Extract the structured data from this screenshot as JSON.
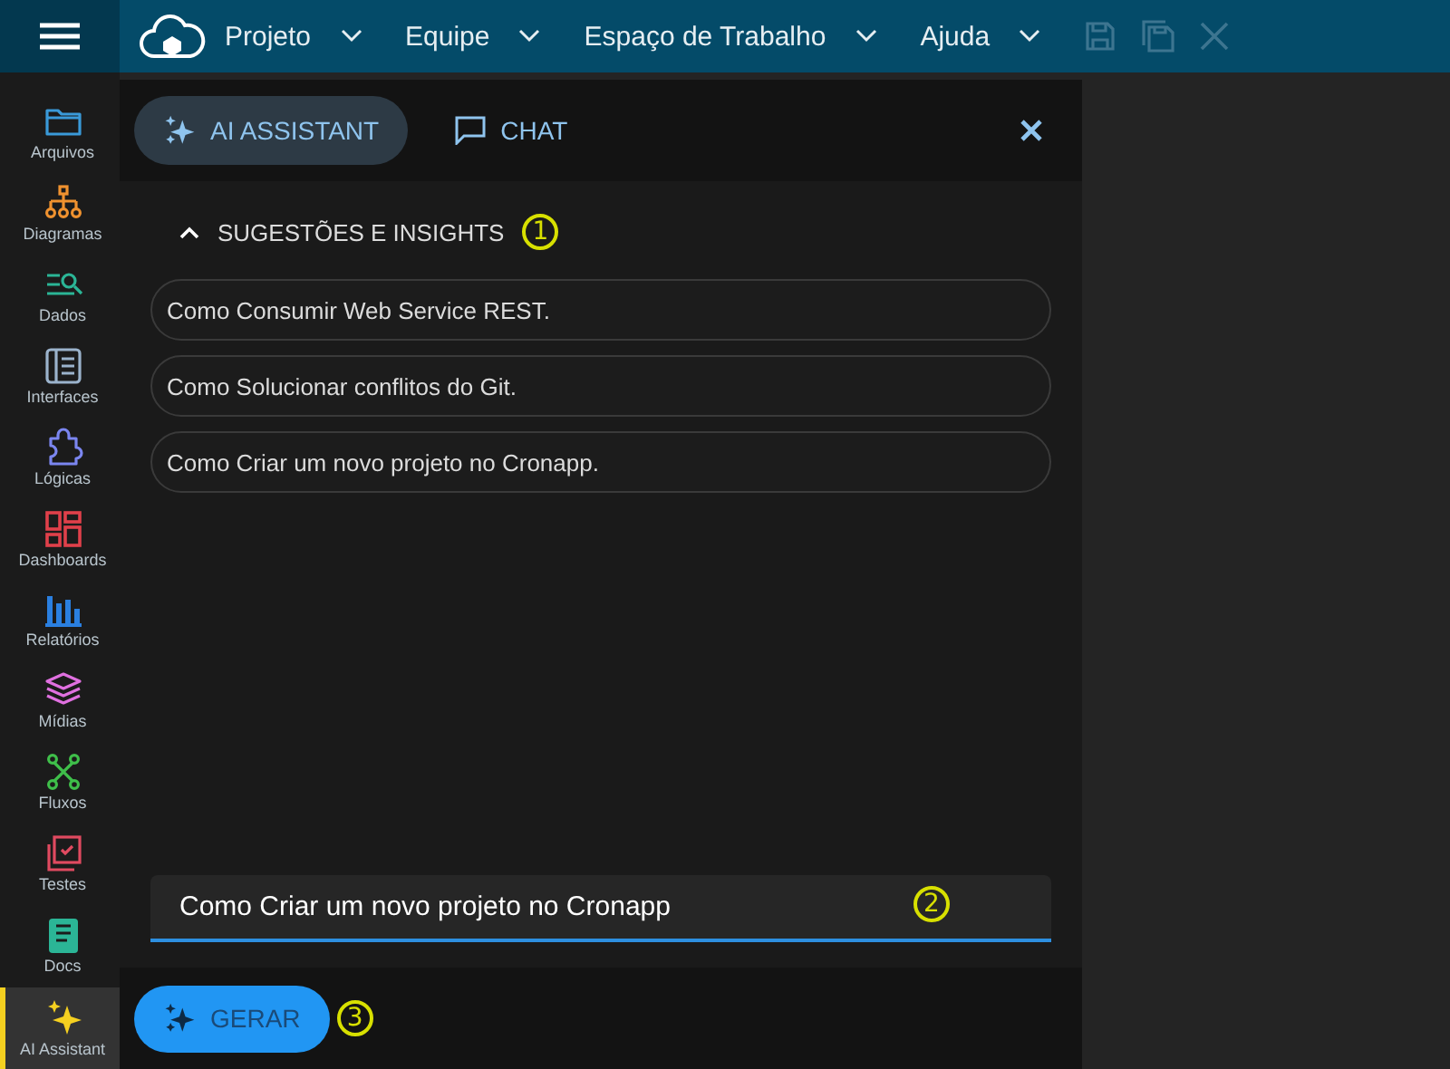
{
  "menu": [
    {
      "label": "Projeto"
    },
    {
      "label": "Equipe"
    },
    {
      "label": "Espaço de Trabalho"
    },
    {
      "label": "Ajuda"
    }
  ],
  "sidebar": {
    "items": [
      {
        "label": "Arquivos",
        "color": "#3a9ad9",
        "selected": false
      },
      {
        "label": "Diagramas",
        "color": "#f0922f",
        "selected": false
      },
      {
        "label": "Dados",
        "color": "#2bb596",
        "selected": false
      },
      {
        "label": "Interfaces",
        "color": "#9bb3cc",
        "selected": false
      },
      {
        "label": "Lógicas",
        "color": "#7b86f0",
        "selected": false
      },
      {
        "label": "Dashboards",
        "color": "#e0404a",
        "selected": false
      },
      {
        "label": "Relatórios",
        "color": "#2a7fe0",
        "selected": false
      },
      {
        "label": "Mídias",
        "color": "#e070e0",
        "selected": false
      },
      {
        "label": "Fluxos",
        "color": "#3fbf4a",
        "selected": false
      },
      {
        "label": "Testes",
        "color": "#e04a60",
        "selected": false
      },
      {
        "label": "Docs",
        "color": "#2bb596",
        "selected": false
      },
      {
        "label": "AI Assistant",
        "color": "#f5d020",
        "selected": true
      }
    ]
  },
  "panel": {
    "tabs": [
      {
        "label": "AI ASSISTANT",
        "selected": true
      },
      {
        "label": "CHAT",
        "selected": false
      }
    ],
    "section": {
      "title": "SUGESTÕES E INSIGHTS",
      "expanded": true,
      "callout": "1"
    },
    "suggestions": [
      "Como Consumir Web Service REST.",
      "Como Solucionar conflitos do Git.",
      "Como Criar um novo projeto no Cronapp."
    ],
    "input": {
      "value": "Como Criar um novo projeto no Cronapp",
      "callout": "2"
    },
    "button": {
      "label": "GERAR",
      "callout": "3"
    }
  }
}
